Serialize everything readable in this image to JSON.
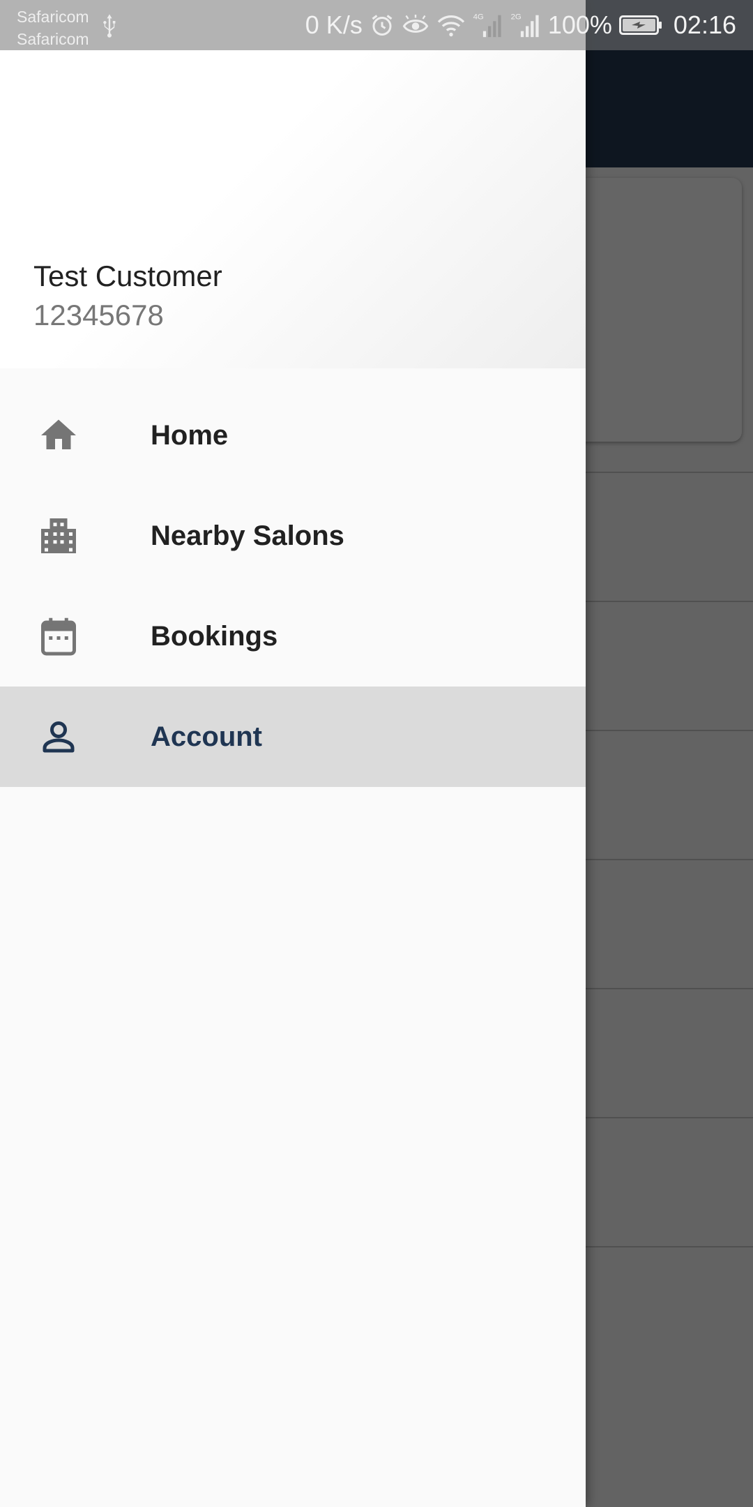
{
  "status_bar": {
    "carrier_1": "Safaricom",
    "carrier_2": "Safaricom",
    "net_speed": "0 K/s",
    "battery_pct": "100%",
    "time": "02:16",
    "icons": [
      "usb-icon",
      "alarm-icon",
      "eye-comfort-icon",
      "wifi-icon",
      "signal-4g-icon",
      "signal-2g-icon",
      "battery-charging-icon"
    ]
  },
  "drawer": {
    "user_name": "Test Customer",
    "user_phone": "12345678",
    "items": [
      {
        "label": "Home",
        "icon": "home-icon",
        "active": false
      },
      {
        "label": "Nearby Salons",
        "icon": "building-icon",
        "active": false
      },
      {
        "label": "Bookings",
        "icon": "calendar-icon",
        "active": false
      },
      {
        "label": "Account",
        "icon": "person-icon",
        "active": true
      }
    ]
  },
  "colors": {
    "toolbar": "#0e1620",
    "drawer_bg": "#fafafa",
    "active_item_bg": "#dbdbdb",
    "active_item_text": "#1f3552",
    "icon_gray": "#757575"
  }
}
